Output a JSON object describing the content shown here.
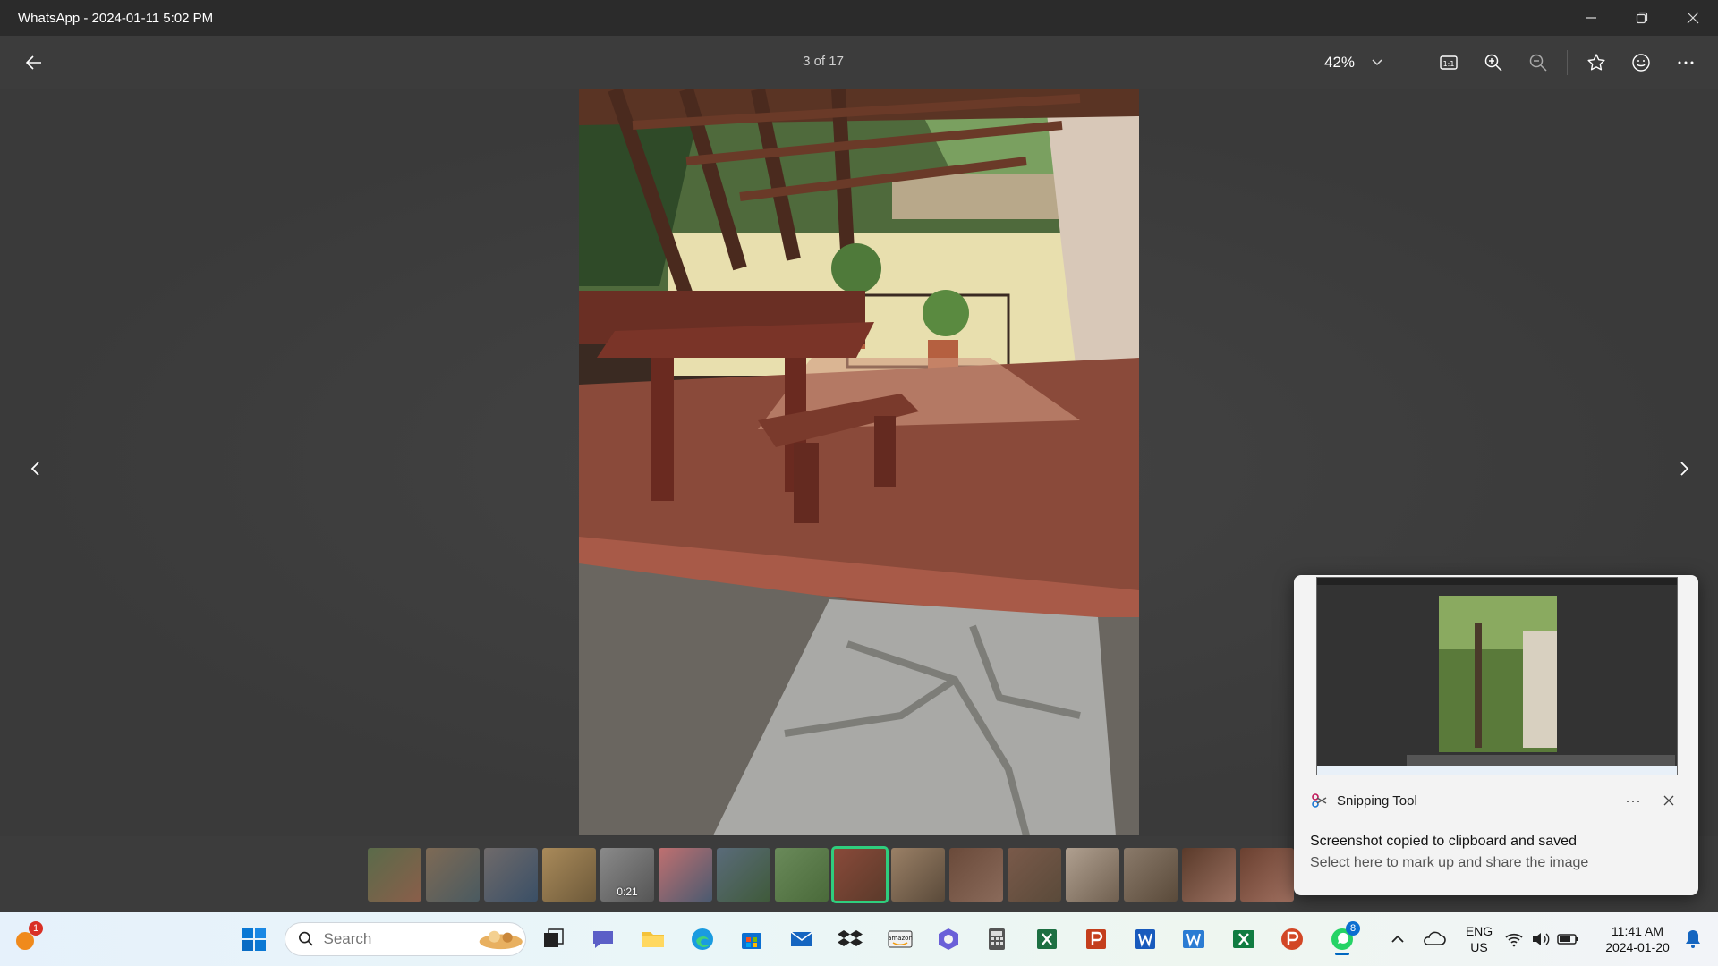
{
  "window": {
    "title": "WhatsApp - 2024-01-11 5:02 PM"
  },
  "toolbar": {
    "counter": "3 of 17",
    "zoom": "42%"
  },
  "filmstrip": {
    "items": [
      {
        "color_a": "#5a6b4a",
        "color_b": "#8a5e4a"
      },
      {
        "color_a": "#7e6a55",
        "color_b": "#4a5a60"
      },
      {
        "color_a": "#6f6a6a",
        "color_b": "#3a4f66"
      },
      {
        "color_a": "#a98a5a",
        "color_b": "#6e5a3a"
      },
      {
        "color_a": "#8a8a8a",
        "color_b": "#555",
        "duration": "0:21"
      },
      {
        "color_a": "#c07070",
        "color_b": "#4a5a70"
      },
      {
        "color_a": "#5a6b7a",
        "color_b": "#3f5a3a"
      },
      {
        "color_a": "#6a8a5a",
        "color_b": "#4a6a3a"
      },
      {
        "color_a": "#8a4a3a",
        "color_b": "#5a3a2a",
        "selected": true
      },
      {
        "color_a": "#9a8066",
        "color_b": "#5a4a3a"
      },
      {
        "color_a": "#6a4a3a",
        "color_b": "#8a6a5a"
      },
      {
        "color_a": "#7a5a4a",
        "color_b": "#5a4a3a"
      },
      {
        "color_a": "#b0a090",
        "color_b": "#706050"
      },
      {
        "color_a": "#8a7a6a",
        "color_b": "#5a4a3a"
      },
      {
        "color_a": "#5a3a2a",
        "color_b": "#9a7060"
      },
      {
        "color_a": "#6a4030",
        "color_b": "#a07060"
      }
    ]
  },
  "toast": {
    "app_name": "Snipping Tool",
    "title": "Screenshot copied to clipboard and saved",
    "body": "Select here to mark up and share the image"
  },
  "taskbar": {
    "search_placeholder": "Search",
    "weather_badge": "1",
    "whatsapp_badge": "8",
    "lang_top": "ENG",
    "lang_bottom": "US",
    "time": "11:41 AM",
    "date": "2024-01-20"
  },
  "colors": {
    "selected": "#2fce7e",
    "accent": "#0067c0"
  }
}
